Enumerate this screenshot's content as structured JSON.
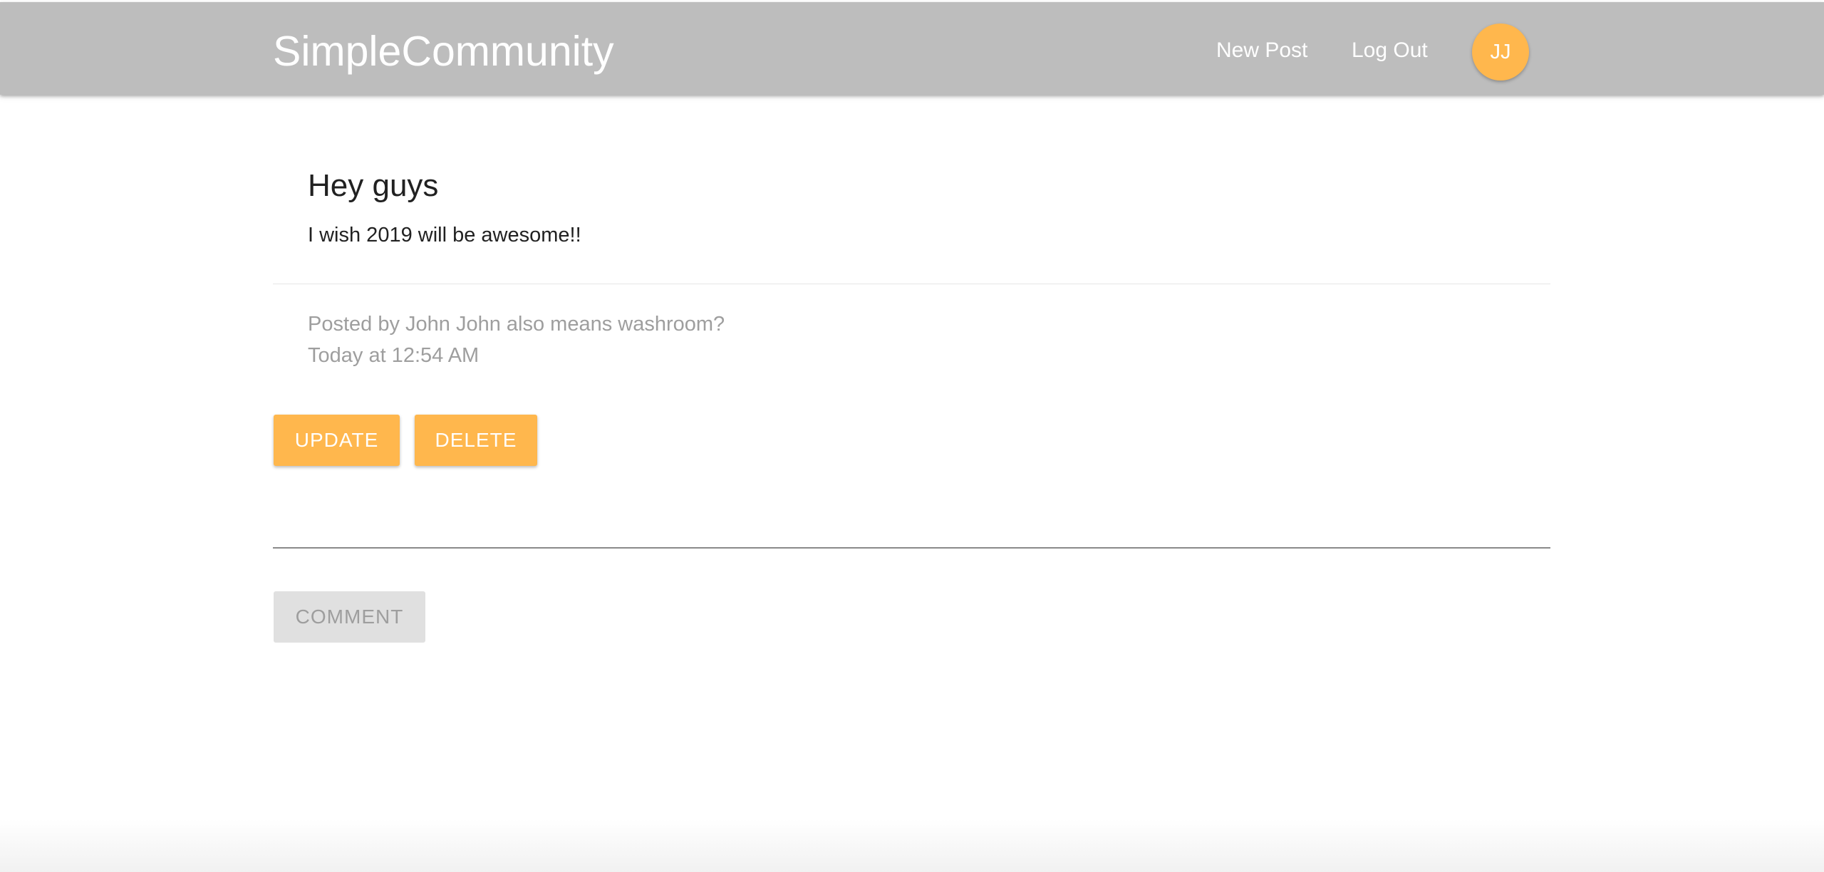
{
  "header": {
    "brand": "SimpleCommunity",
    "nav": {
      "new_post": "New Post",
      "log_out": "Log Out"
    },
    "avatar_initials": "JJ",
    "avatar_color": "#ffb74d",
    "bar_color": "#bdbdbd"
  },
  "post": {
    "title": "Hey guys",
    "body": "I wish 2019 will be awesome!!",
    "author_line": "Posted by John John also means washroom?",
    "timestamp": "Today at 12:54 AM"
  },
  "actions": {
    "update_label": "UPDATE",
    "delete_label": "DELETE"
  },
  "comment": {
    "input_value": "",
    "submit_label": "COMMENT"
  },
  "colors": {
    "accent": "#ffb74d",
    "disabled_bg": "#e0e0e0",
    "muted_text": "#9e9e9e"
  }
}
